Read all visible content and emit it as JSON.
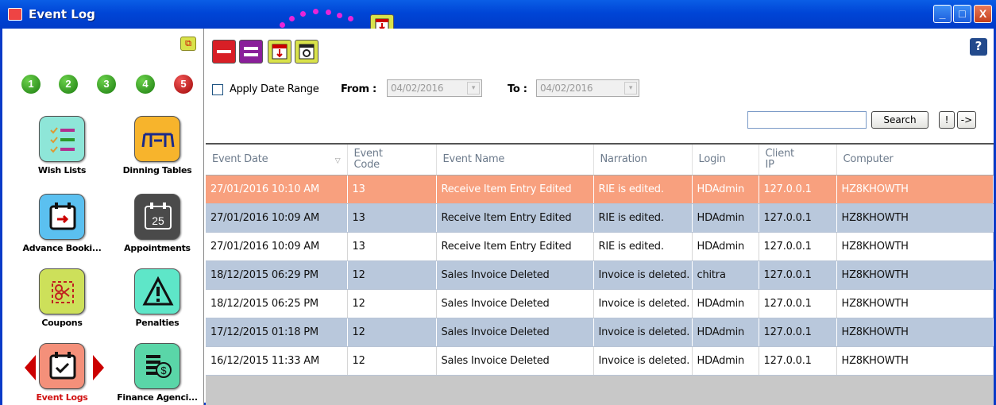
{
  "window": {
    "title": "Event Log",
    "minimize": "_",
    "maximize": "□",
    "close": "X"
  },
  "sidebar": {
    "page_numbers": [
      "1",
      "2",
      "3",
      "4",
      "5"
    ],
    "active_page": "5",
    "tiles": [
      {
        "label": "Wish Lists",
        "icon": "checklist-icon",
        "color": "#8ee6d8"
      },
      {
        "label": "Dinning Tables",
        "icon": "dining-table-icon",
        "color": "#f7b42c"
      },
      {
        "label": "Advance Booki...",
        "icon": "calendar-arrow-icon",
        "color": "#5bc0f0"
      },
      {
        "label": "Appointments",
        "icon": "calendar-25-icon",
        "color": "#5a5a5a"
      },
      {
        "label": "Coupons",
        "icon": "coupon-scissors-icon",
        "color": "#cde05a"
      },
      {
        "label": "Penalties",
        "icon": "warning-icon",
        "color": "#5ee6c8"
      },
      {
        "label": "Event Logs",
        "icon": "calendar-check-icon",
        "color": "#f4907a"
      },
      {
        "label": "Finance Agenci...",
        "icon": "money-stack-icon",
        "color": "#5ad6a8"
      }
    ]
  },
  "toolbar": {
    "help": "?"
  },
  "filters": {
    "apply_date_range": "Apply Date Range",
    "from_label": "From :",
    "from_value": "04/02/2016",
    "to_label": "To :",
    "to_value": "04/02/2016"
  },
  "search": {
    "button": "Search",
    "bang": "!",
    "arrow": "->"
  },
  "table": {
    "headers": [
      "Event Date",
      "Event Code",
      "Event Name",
      "Narration",
      "Login",
      "Client IP",
      "Computer"
    ],
    "rows": [
      [
        "27/01/2016 10:10 AM",
        "13",
        "Receive Item Entry Edited",
        "RIE is edited.",
        "HDAdmin",
        "127.0.0.1",
        "HZ8KHOWTH"
      ],
      [
        "27/01/2016 10:09 AM",
        "13",
        "Receive Item Entry Edited",
        "RIE is edited.",
        "HDAdmin",
        "127.0.0.1",
        "HZ8KHOWTH"
      ],
      [
        "27/01/2016 10:09 AM",
        "13",
        "Receive Item Entry Edited",
        "RIE is edited.",
        "HDAdmin",
        "127.0.0.1",
        "HZ8KHOWTH"
      ],
      [
        "18/12/2015 06:29 PM",
        "12",
        "Sales Invoice Deleted",
        "Invoice is deleted.",
        "chitra",
        "127.0.0.1",
        "HZ8KHOWTH"
      ],
      [
        "18/12/2015 06:25 PM",
        "12",
        "Sales Invoice Deleted",
        "Invoice is deleted.",
        "HDAdmin",
        "127.0.0.1",
        "HZ8KHOWTH"
      ],
      [
        "17/12/2015 01:18 PM",
        "12",
        "Sales Invoice Deleted",
        "Invoice is deleted.",
        "HDAdmin",
        "127.0.0.1",
        "HZ8KHOWTH"
      ],
      [
        "16/12/2015 11:33 AM",
        "12",
        "Sales Invoice Deleted",
        "Invoice is deleted.",
        "HDAdmin",
        "127.0.0.1",
        "HZ8KHOWTH"
      ]
    ]
  },
  "colors": {
    "selected_row": "#f8a07e",
    "alt_row": "#b9c8dc",
    "titlebar": "#0045d6"
  }
}
